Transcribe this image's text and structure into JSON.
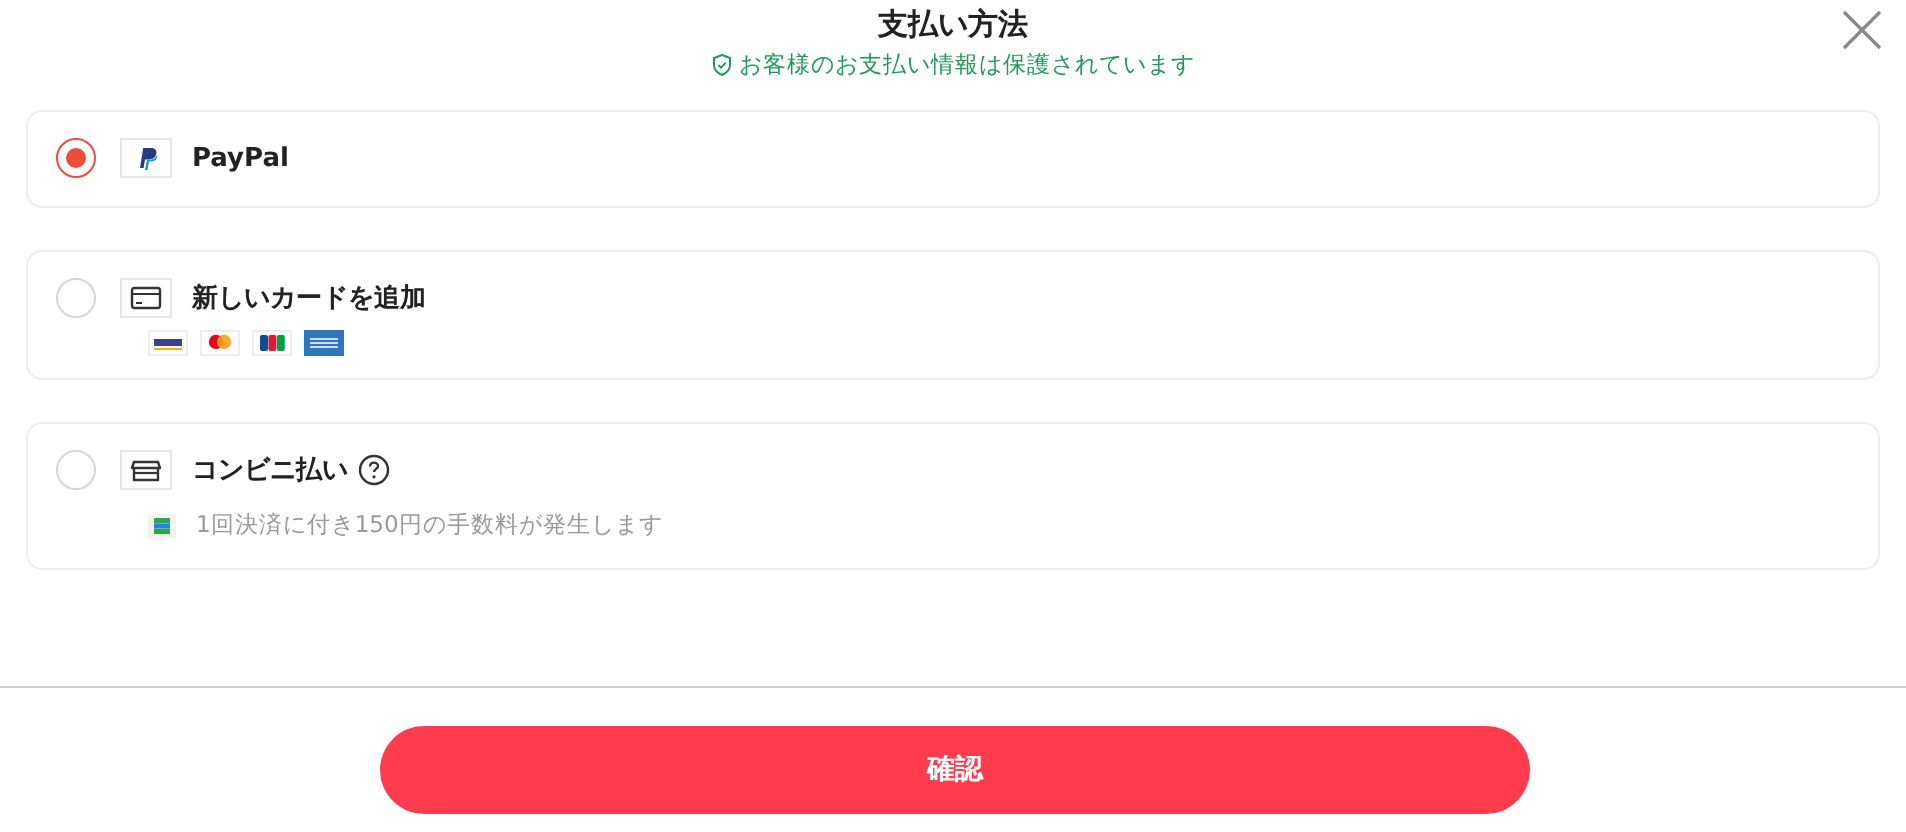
{
  "title": "支払い方法",
  "security_note": "お客様のお支払い情報は保護されています",
  "options": [
    {
      "kind": "paypal",
      "label": "PayPal",
      "selected": true
    },
    {
      "kind": "card",
      "label": "新しいカードを追加",
      "selected": false
    },
    {
      "kind": "konbini",
      "label": "コンビニ払い",
      "selected": false,
      "note": "1回決済に付き150円の手数料が発生します"
    }
  ],
  "confirm_button": "確認"
}
